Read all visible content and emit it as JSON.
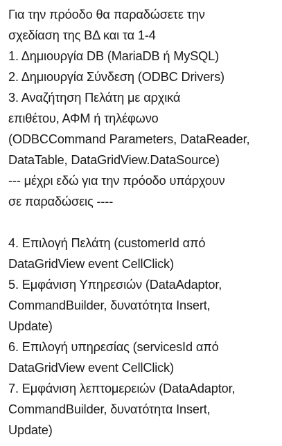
{
  "message": {
    "lines": [
      "Για την πρόοδο θα παραδώσετε την",
      "σχεδίαση της ΒΔ και τα 1-4",
      "1. Δημιουργία DB (MariaDB ή MySQL)",
      "2. Δημιουργία Σύνδεση (ODBC Drivers)",
      "3. Αναζήτηση Πελάτη με αρχικά",
      "επιθέτου, ΑΦΜ ή τηλέφωνο",
      "(ODBCCommand Parameters, DataReader,",
      "DataTable, DataGridView.DataSource)",
      "--- μέχρι εδώ για την πρόοδο υπάρχουν",
      "σε παραδώσεις ----",
      "",
      "4. Επιλογή Πελάτη (customerId από",
      "DataGridView event CellClick)",
      "5. Εμφάνιση Υπηρεσιών (DataAdaptor,",
      "CommandBuilder, δυνατότητα Insert,",
      "Update)",
      "6. Επιλογή υπηρεσίας (servicesId από",
      "DataGridView event CellClick)",
      "7. Εμφάνιση λεπτομερειών (DataAdaptor,",
      "CommandBuilder, δυνατότητα Insert,",
      "Update)"
    ]
  }
}
